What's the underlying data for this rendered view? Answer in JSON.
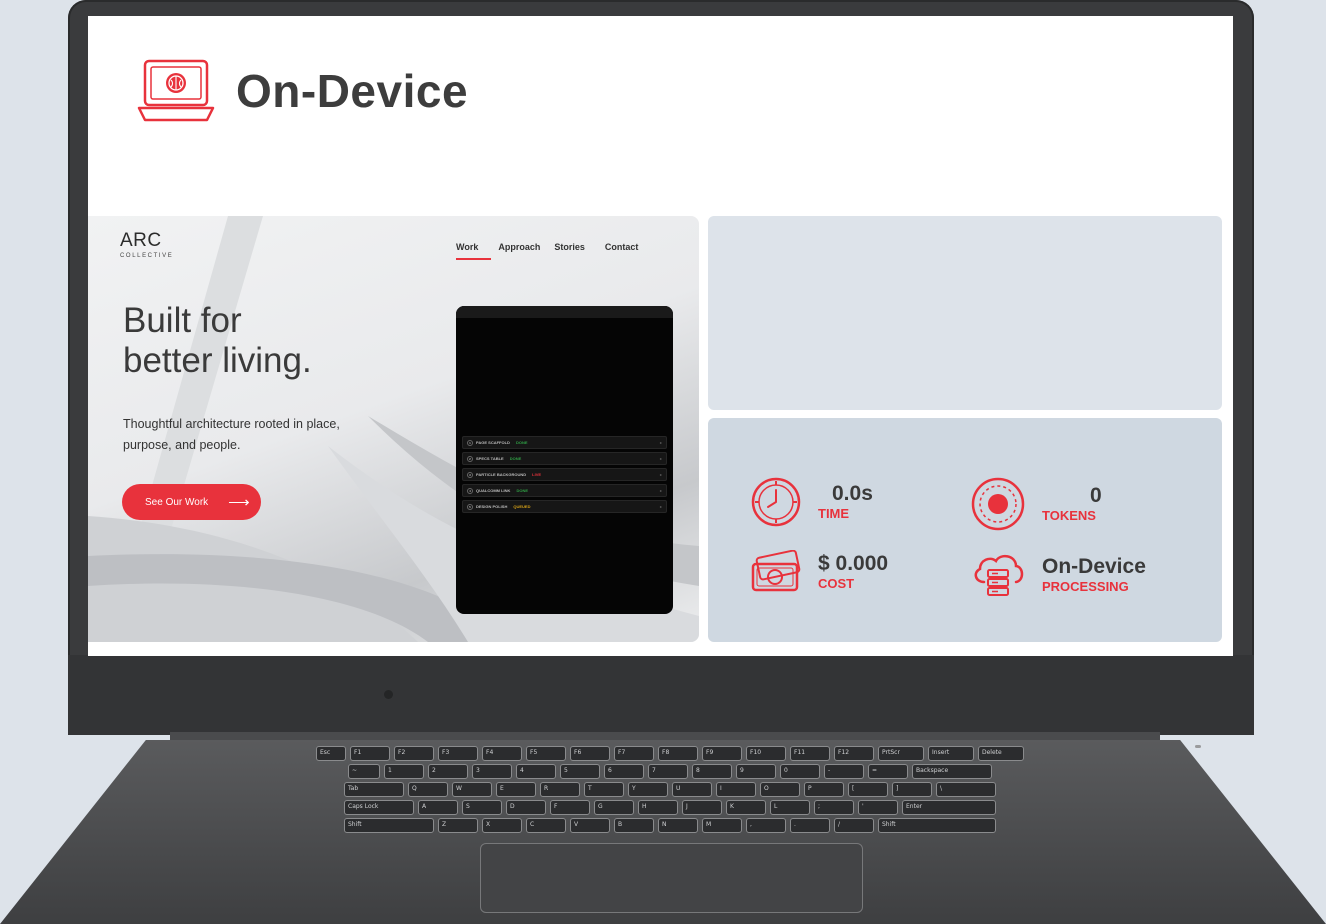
{
  "app": {
    "title": "On-Device",
    "icon": "laptop-brain-icon",
    "accent_color": "#e8323c"
  },
  "website_preview": {
    "logo_main": "ARC",
    "logo_sub": "COLLECTIVE",
    "nav": [
      {
        "label": "Work",
        "active": true
      },
      {
        "label": "Approach",
        "active": false
      },
      {
        "label": "Stories",
        "active": false
      },
      {
        "label": "Contact",
        "active": false
      }
    ],
    "headline_line1": "Built for",
    "headline_line2": "better living.",
    "subtext": "Thoughtful architecture rooted in place, purpose, and people.",
    "cta_label": "See Our Work",
    "cta_arrow": "⟶",
    "tasks": [
      {
        "num": "1",
        "name": "PAGE SCAFFOLD",
        "status": "DONE",
        "status_color": "#2f9e44"
      },
      {
        "num": "2",
        "name": "SPECS TABLE",
        "status": "DONE",
        "status_color": "#2f9e44"
      },
      {
        "num": "3",
        "name": "PARTICLE BACKGROUND",
        "status": "LIVE",
        "status_color": "#e8323c"
      },
      {
        "num": "4",
        "name": "QUALCOMM LINK",
        "status": "DONE",
        "status_color": "#2f9e44"
      },
      {
        "num": "5",
        "name": "DESIGN POLISH",
        "status": "QUEUED",
        "status_color": "#d4a017"
      }
    ]
  },
  "stats": {
    "time": {
      "value": "0.0s",
      "label": "TIME",
      "icon": "clock-icon"
    },
    "tokens": {
      "value": "0",
      "label": "TOKENS",
      "icon": "record-icon"
    },
    "cost": {
      "value": "$ 0.000",
      "label": "COST",
      "icon": "money-icon"
    },
    "processing": {
      "value": "On-Device",
      "label": "PROCESSING",
      "icon": "cloud-server-icon"
    }
  }
}
